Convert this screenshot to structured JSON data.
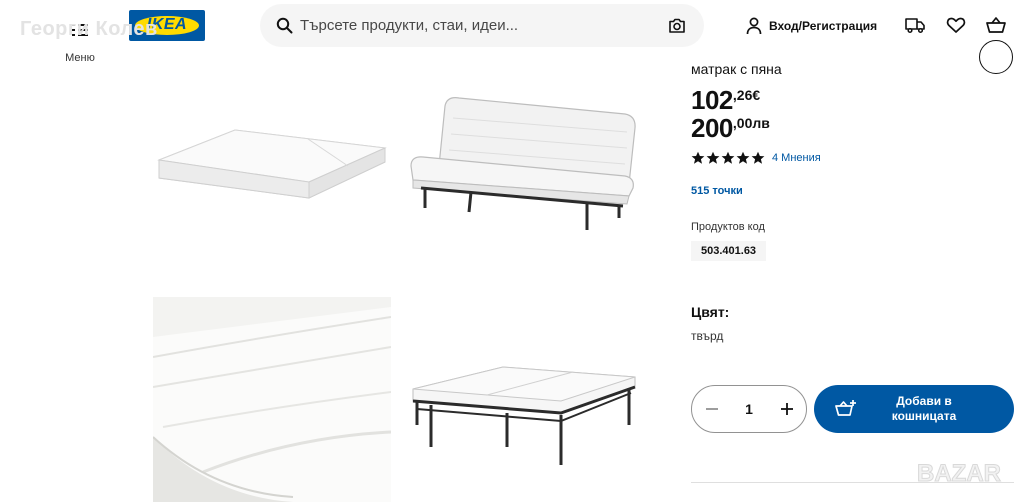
{
  "header": {
    "watermark_text": "Георги Колев",
    "menu_label": "Меню",
    "logo_text": "IKEA",
    "search_placeholder": "Търсете продукти, стаи, идеи...",
    "login_label": "Вход/Регистрация",
    "icons": [
      "menu-icon",
      "search-icon",
      "camera-icon",
      "person-icon",
      "truck-icon",
      "heart-icon",
      "shopping-bag-icon"
    ]
  },
  "gallery": {
    "images": [
      "mattress-folded",
      "sofa-bed-seated",
      "mattress-closeup",
      "sofa-bed-unfolded"
    ]
  },
  "product": {
    "subtitle": "матрак с пяна",
    "price_eur": {
      "integer": "102",
      "decimal": ",26€"
    },
    "price_bgn": {
      "integer": "200",
      "decimal": ",00лв"
    },
    "rating": {
      "stars": 5,
      "max": 5,
      "reviews_label": "4 Мнения"
    },
    "points_label": "515 точки",
    "code_label": "Продуктов код",
    "code_value": "503.401.63",
    "color_label": "Цвят:",
    "color_value": "твърд",
    "quantity": "1",
    "add_to_cart_label": "Добави в кошницата"
  },
  "watermark_logo": "BAZAR",
  "colors": {
    "ikea_blue": "#0058a3",
    "ikea_yellow": "#ffdb00",
    "search_bg": "#f5f5f5",
    "link_blue": "#0058a3"
  }
}
